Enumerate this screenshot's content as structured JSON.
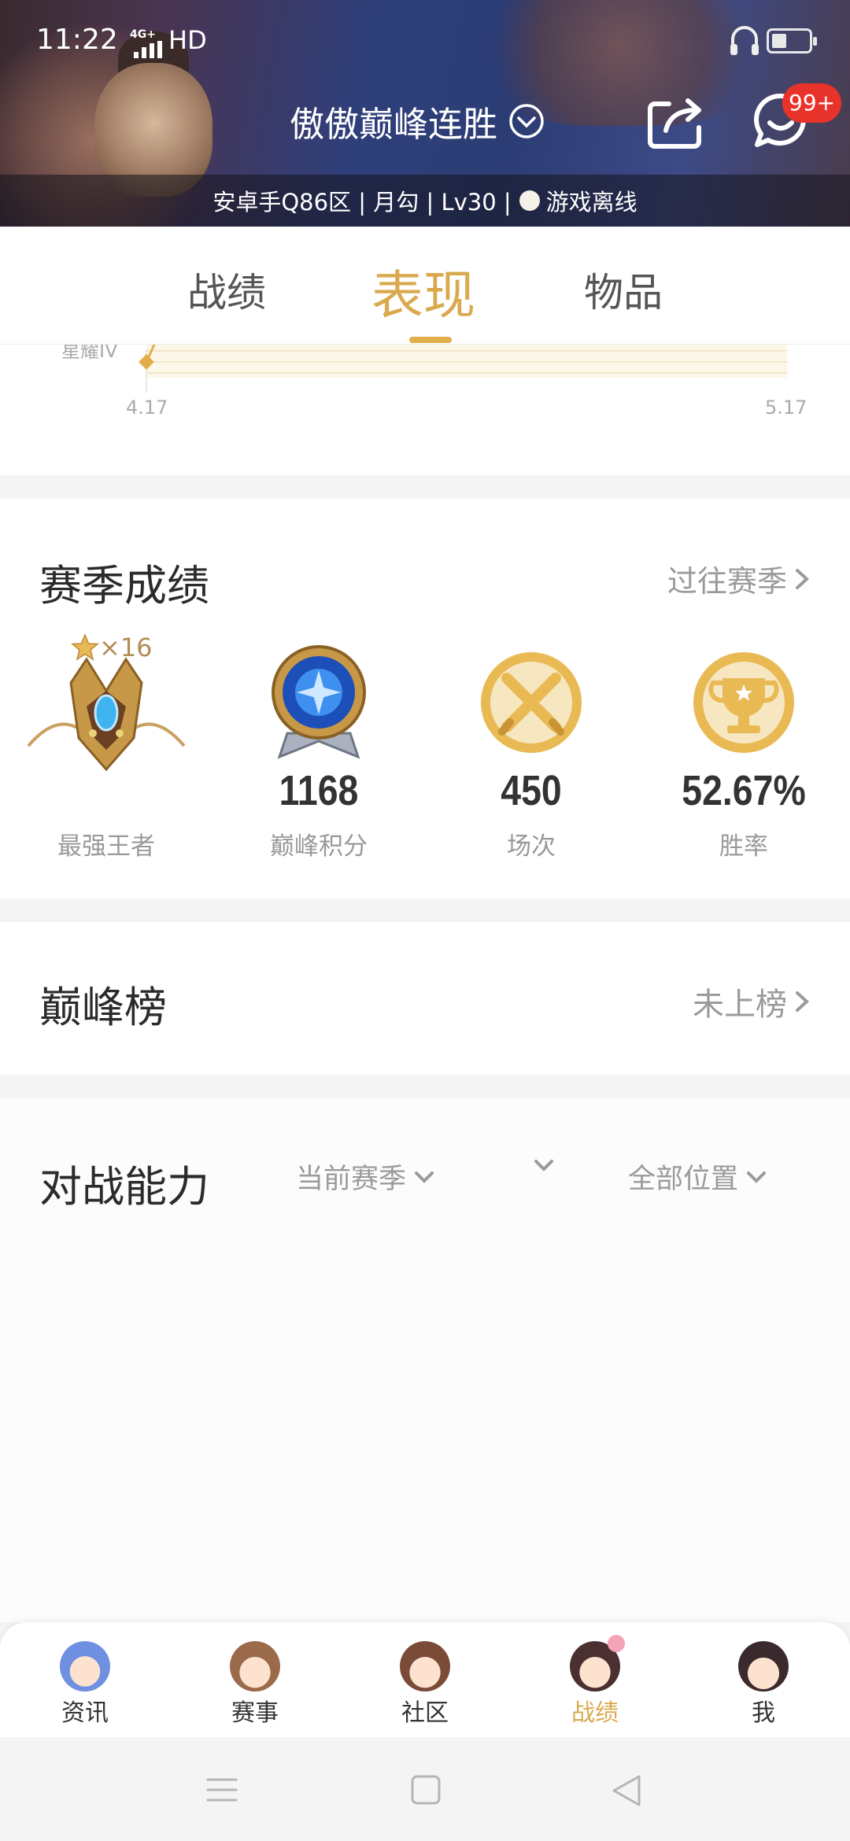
{
  "status_bar": {
    "time": "11:22",
    "network": "4G+",
    "hd": "HD"
  },
  "header": {
    "player_name": "傲傲巅峰连胜",
    "message_badge": "99+",
    "server_info": "安卓手Q86区 | 月勾 | Lv30 |",
    "online_status": "游戏离线"
  },
  "tabs": [
    {
      "label": "战绩"
    },
    {
      "label": "表现"
    },
    {
      "label": "物品"
    }
  ],
  "chart_data": {
    "type": "line",
    "y_tick_visible": "星耀IV",
    "x_ticks": [
      "4.17",
      "5.17"
    ]
  },
  "season": {
    "title": "赛季成绩",
    "link": "过往赛季",
    "star_multiplier": "×16",
    "items": [
      {
        "label": "最强王者",
        "value": ""
      },
      {
        "label": "巅峰积分",
        "value": "1168"
      },
      {
        "label": "场次",
        "value": "450"
      },
      {
        "label": "胜率",
        "value": "52.67%"
      }
    ]
  },
  "peak_rank": {
    "title": "巅峰榜",
    "status": "未上榜"
  },
  "ability": {
    "title": "对战能力",
    "filter_season": "当前赛季",
    "filter_middle": "",
    "filter_position": "全部位置"
  },
  "bottom_nav": [
    {
      "label": "资讯"
    },
    {
      "label": "赛事"
    },
    {
      "label": "社区"
    },
    {
      "label": "战绩"
    },
    {
      "label": "我"
    }
  ],
  "colors": {
    "accent": "#d9a94d",
    "badge": "#e8332a",
    "gold_icon": "#e9b954"
  }
}
